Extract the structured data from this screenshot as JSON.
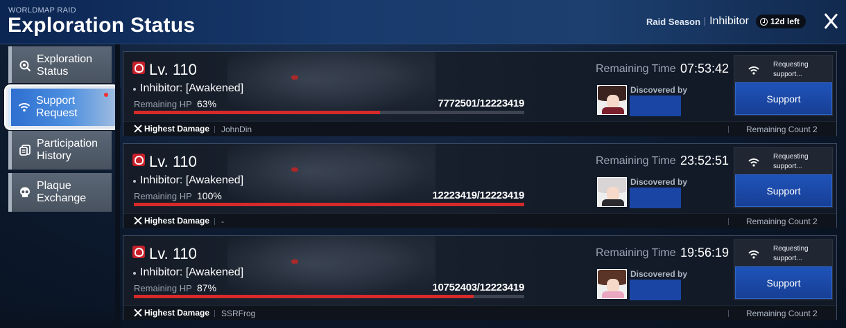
{
  "header": {
    "subtitle": "WORLDMAP RAID",
    "title": "Exploration Status",
    "season_label": "Raid Season",
    "season_boss": "Inhibitor",
    "time_left": "12d left"
  },
  "sidebar": {
    "items": [
      {
        "line1": "Exploration",
        "line2": "Status",
        "icon": "magnifier-icon",
        "active": false
      },
      {
        "line1": "Support",
        "line2": "Request",
        "icon": "signal-icon",
        "active": true,
        "notification": true
      },
      {
        "line1": "Participation",
        "line2": "History",
        "icon": "documents-icon",
        "active": false
      },
      {
        "line1": "Plaque",
        "line2": "Exchange",
        "icon": "skull-icon",
        "active": false
      }
    ]
  },
  "raids": [
    {
      "level": "Lv. 110",
      "boss_name": "Inhibitor: [Awakened]",
      "hp_label": "Remaining HP",
      "hp_percent": "63%",
      "hp_fraction": 0.63,
      "hp_values": "7772501/12223419",
      "remaining_time_label": "Remaining Time",
      "remaining_time": "07:53:42",
      "discovered_by_label": "Discovered by",
      "requesting_text": "Requesting support...",
      "support_label": "Support",
      "highest_damage_label": "Highest Damage",
      "highest_damage_name": "JohnDin",
      "remaining_count": "Remaining Count 2",
      "avatar_colors": {
        "hair": "#3b2420",
        "body": "#7a1f2b"
      }
    },
    {
      "level": "Lv. 110",
      "boss_name": "Inhibitor: [Awakened]",
      "hp_label": "Remaining HP",
      "hp_percent": "100%",
      "hp_fraction": 1.0,
      "hp_values": "12223419/12223419",
      "remaining_time_label": "Remaining Time",
      "remaining_time": "23:52:51",
      "discovered_by_label": "Discovered by",
      "requesting_text": "Requesting support...",
      "support_label": "Support",
      "highest_damage_label": "Highest Damage",
      "highest_damage_name": "-",
      "remaining_count": "Remaining Count 2",
      "avatar_colors": {
        "hair": "#d9d4d6",
        "body": "#2a2a2e"
      }
    },
    {
      "level": "Lv. 110",
      "boss_name": "Inhibitor: [Awakened]",
      "hp_label": "Remaining HP",
      "hp_percent": "87%",
      "hp_fraction": 0.87,
      "hp_values": "10752403/12223419",
      "remaining_time_label": "Remaining Time",
      "remaining_time": "19:56:19",
      "discovered_by_label": "Discovered by",
      "requesting_text": "Requesting support...",
      "support_label": "Support",
      "highest_damage_label": "Highest Damage",
      "highest_damage_name": "SSRFrog",
      "remaining_count": "Remaining Count 2",
      "avatar_colors": {
        "hair": "#5a3426",
        "body": "#e9a7c0"
      }
    }
  ],
  "colors": {
    "accent_blue": "#1f53b9",
    "hp_red": "#d62a2a",
    "notification_red": "#e33333"
  }
}
